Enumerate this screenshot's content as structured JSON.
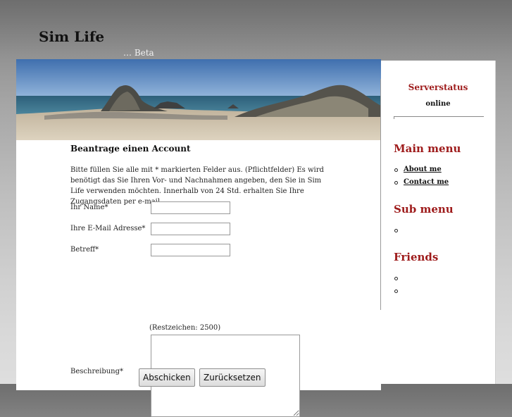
{
  "site": {
    "title": "Sim Life",
    "subtitle": "… Beta"
  },
  "form": {
    "title": "Beantrage einen Account",
    "intro": "Bitte füllen Sie alle mit * markierten Felder aus. (Pflichtfelder) Es wird benötigt das Sie Ihren Vor- und Nachnahmen angeben, den Sie in Sim Life verwenden möchten. Innerhalb von 24 Std. erhalten Sie Ihre Zugangsdaten per e-mail.",
    "fields": [
      {
        "label": "Ihr Name*",
        "value": ""
      },
      {
        "label": "Ihre E-Mail Adresse*",
        "value": ""
      },
      {
        "label": "Betreff*",
        "value": ""
      }
    ],
    "counter": "(Restzeichen: 2500)",
    "description_label": "Beschreibung*",
    "description_value": "",
    "submit_label": "Abschicken",
    "reset_label": "Zurücksetzen"
  },
  "sidebar": {
    "server_status_title": "Serverstatus",
    "server_status_value": "online",
    "main_menu_title": "Main menu",
    "main_menu_items": [
      "About me",
      "Contact me"
    ],
    "sub_menu_title": "Sub menu",
    "sub_menu_items": [
      ""
    ],
    "friends_title": "Friends",
    "friends_items": [
      "",
      ""
    ]
  }
}
